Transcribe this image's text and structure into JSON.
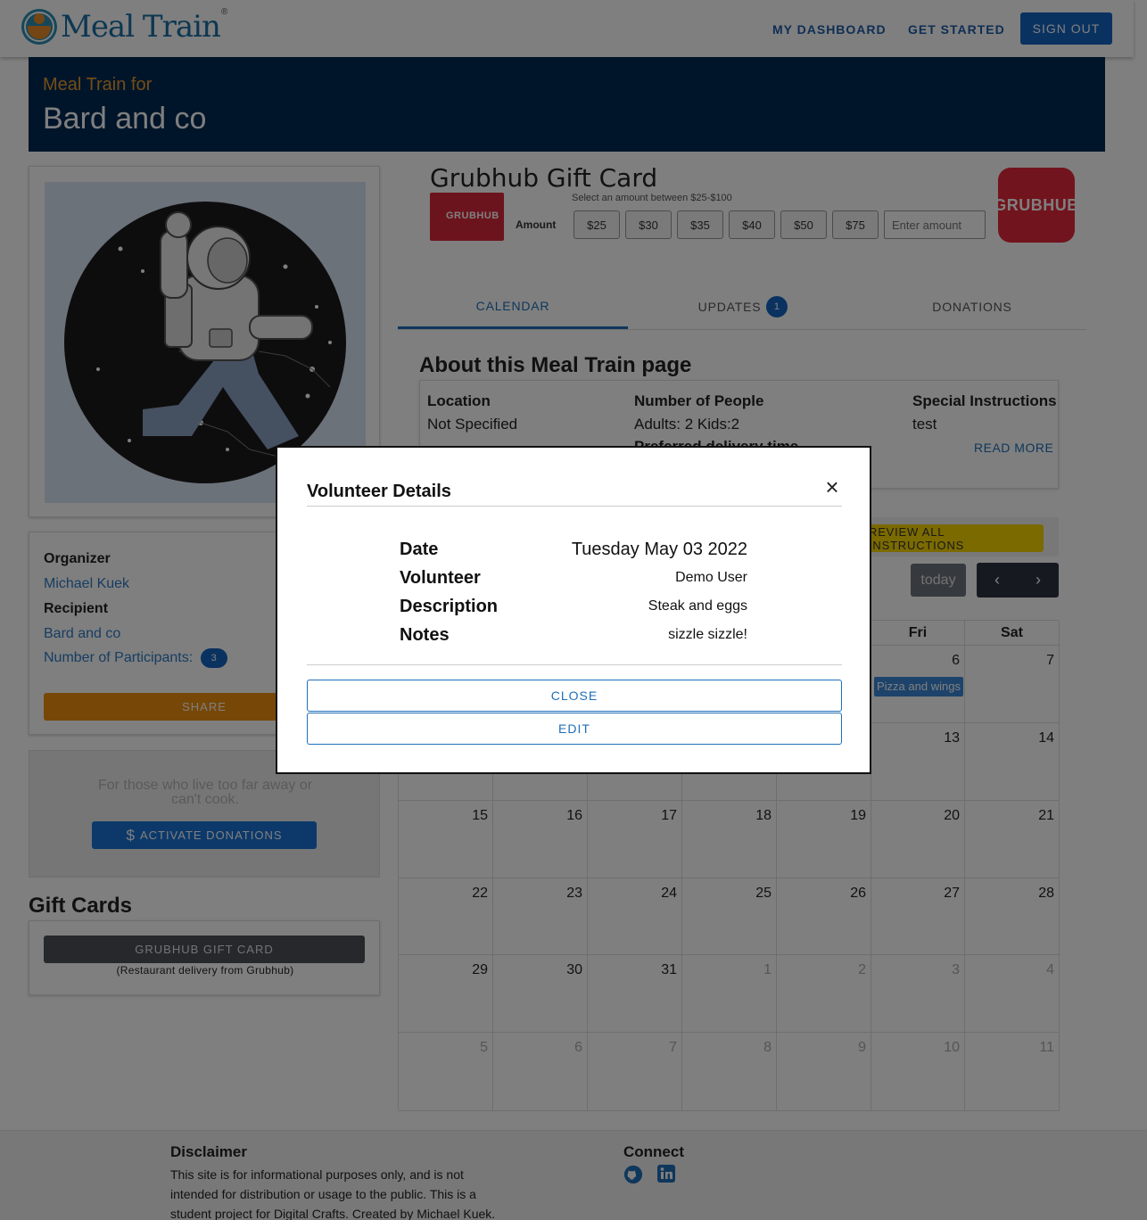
{
  "header": {
    "brand": "Meal Train",
    "registered": "®",
    "nav": {
      "dashboard": "MY DASHBOARD",
      "get_started": "GET STARTED",
      "sign_out": "SIGN OUT"
    }
  },
  "banner": {
    "subtitle": "Meal Train for",
    "title": "Bard and co"
  },
  "sidebar": {
    "organizer_label": "Organizer",
    "organizer_name": "Michael Kuek",
    "recipient_label": "Recipient",
    "recipient_name": "Bard and co",
    "participants_label": "Number of Participants:",
    "participants_count": "3",
    "share_button": "SHARE",
    "donation_text": "For those who live too far away or can't cook.",
    "activate_button": "ACTIVATE DONATIONS",
    "gift_cards_title": "Gift Cards",
    "grubhub_button": "GRUBHUB GIFT CARD",
    "grubhub_caption": "(Restaurant delivery from Grubhub)"
  },
  "gift_card": {
    "title": "Grubhub Gift Card",
    "hint": "Select an amount between $25-$100",
    "thumb_label": "GRUBHUB",
    "amount_label": "Amount",
    "amounts": [
      "$25",
      "$30",
      "$35",
      "$40",
      "$50",
      "$75"
    ],
    "input_placeholder": "Enter amount",
    "logo_text": "GRUBHUB"
  },
  "tabs": {
    "calendar": "CALENDAR",
    "updates": "UPDATES",
    "updates_badge": "1",
    "donations": "DONATIONS"
  },
  "about": {
    "title": "About this Meal Train page",
    "location_label": "Location",
    "location_value": "Not Specified",
    "people_label": "Number of People",
    "people_value": "Adults: 2 Kids:2",
    "delivery_label": "Preferred delivery time",
    "instructions_label": "Special Instructions",
    "instructions_value": "test",
    "read_more": "READ MORE"
  },
  "calendar": {
    "review_button": "REVIEW ALL INSTRUCTIONS",
    "today_button": "today",
    "weekday_headers": [
      "Fri",
      "Sat"
    ],
    "visible_numbers": {
      "row1": [
        "6",
        "7"
      ],
      "row2": [
        "13",
        "14"
      ],
      "row3": [
        "15",
        "16",
        "17",
        "18",
        "19",
        "20",
        "21"
      ],
      "row4": [
        "22",
        "23",
        "24",
        "25",
        "26",
        "27",
        "28"
      ],
      "row5": [
        "29",
        "30",
        "31",
        "1",
        "2",
        "3",
        "4"
      ],
      "row6": [
        "5",
        "6",
        "7",
        "8",
        "9",
        "10",
        "11"
      ]
    },
    "event_fri_6": "Pizza and wings"
  },
  "footer": {
    "disclaimer_title": "Disclaimer",
    "disclaimer_text": "This site is for informational purposes only, and is not intended for distribution or usage to the public. This is a student project for Digital Crafts. Created by Michael Kuek.",
    "connect_title": "Connect"
  },
  "modal": {
    "title": "Volunteer Details",
    "date_label": "Date",
    "date_value": "Tuesday May 03 2022",
    "volunteer_label": "Volunteer",
    "volunteer_value": "Demo User",
    "description_label": "Description",
    "description_value": "Steak and eggs",
    "notes_label": "Notes",
    "notes_value": "sizzle sizzle!",
    "close_button": "CLOSE",
    "edit_button": "EDIT"
  },
  "colors": {
    "banner": "#002a55",
    "accent_orange": "#ee8e0e",
    "primary_blue": "#1565c0",
    "link_blue": "#2f7bc4",
    "grubhub_red": "#e4293a",
    "review_yellow": "#f6d500",
    "event_blue": "#3a87d6"
  }
}
